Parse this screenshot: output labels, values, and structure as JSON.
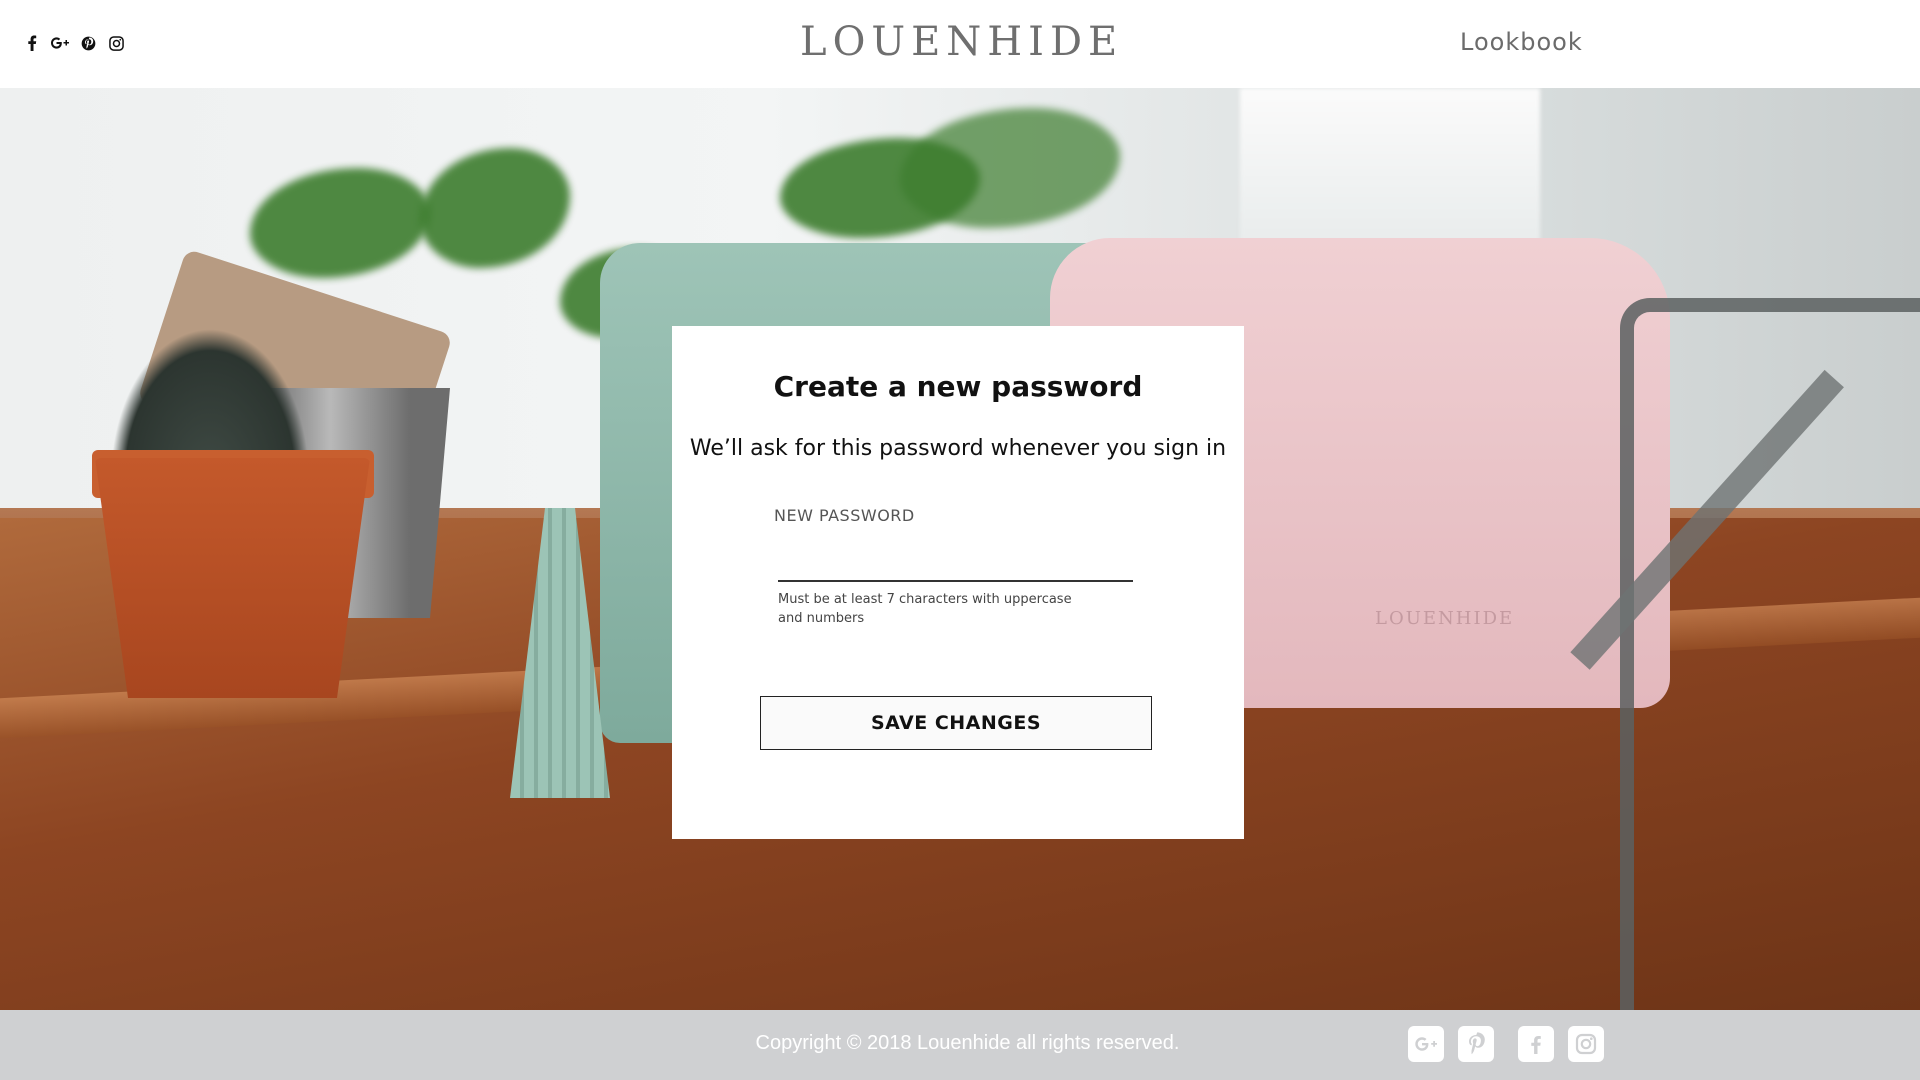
{
  "header": {
    "brand": "LOUENHIDE",
    "nav_lookbook": "Lookbook",
    "social_icons": [
      "facebook-icon",
      "google-plus-icon",
      "pinterest-icon",
      "instagram-icon"
    ]
  },
  "hero": {
    "bag_stamp": "LOUENHIDE"
  },
  "card": {
    "title": "Create a new password",
    "subtitle": "We’ll ask for this password whenever you sign in",
    "field_label": "NEW PASSWORD",
    "field_value": "",
    "hint": "Must be at least 7 characters with uppercase and numbers",
    "save_label": "SAVE CHANGES"
  },
  "footer": {
    "copyright": "Copyright © 2018 Louenhide all rights reserved.",
    "social_icons": [
      "google-plus-icon",
      "pinterest-icon",
      "facebook-icon",
      "instagram-icon"
    ]
  },
  "colors": {
    "footer_bg": "#cfd0d2",
    "logo": "#6f6f6f",
    "text": "#111111"
  }
}
